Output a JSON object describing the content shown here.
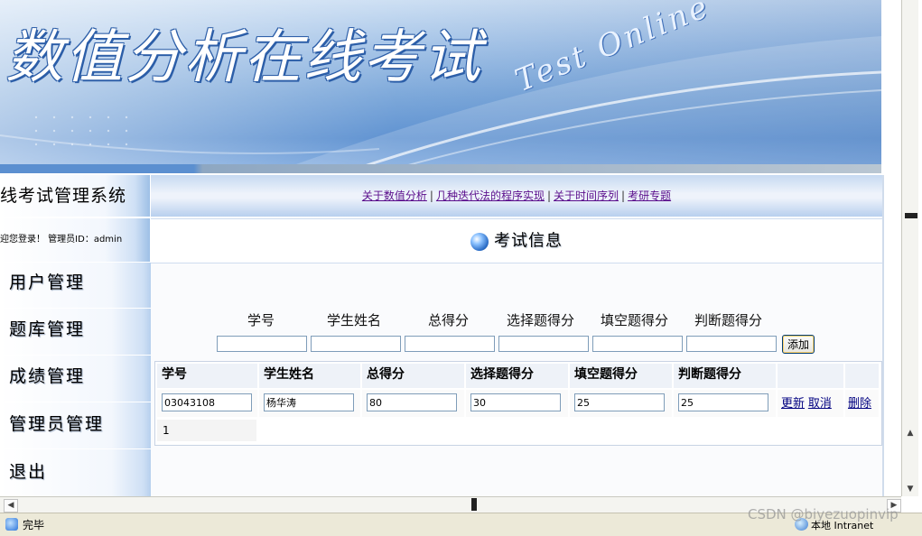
{
  "banner": {
    "title": "数值分析在线考试",
    "subtitle": "Test Online"
  },
  "sidebar": {
    "system_title": "线考试管理系统",
    "welcome": "迎您登录！ 管理员ID：admin",
    "items": [
      {
        "label": "用户管理"
      },
      {
        "label": "题库管理"
      },
      {
        "label": "成绩管理"
      },
      {
        "label": "管理员管理"
      },
      {
        "label": "退出"
      }
    ]
  },
  "toplinks": [
    {
      "label": "关于数值分析"
    },
    {
      "label": "几种迭代法的程序实现"
    },
    {
      "label": "关于时间序列"
    },
    {
      "label": "考研专题"
    }
  ],
  "toplinks_sep": "|",
  "section": {
    "title": "考试信息"
  },
  "add_form": {
    "labels": [
      "学号",
      "学生姓名",
      "总得分",
      "选择题得分",
      "填空题得分",
      "判断题得分"
    ],
    "button_label": "添加"
  },
  "grid": {
    "headers": [
      "学号",
      "学生姓名",
      "总得分",
      "选择题得分",
      "填空题得分",
      "判断题得分"
    ],
    "rows": [
      {
        "student_id": "03043108",
        "name": "杨华涛",
        "total": "80",
        "choice": "30",
        "blank": "25",
        "judge": "25"
      }
    ],
    "update_label": "更新",
    "cancel_label": "取消",
    "delete_label": "删除",
    "pager": "1"
  },
  "statusbar": {
    "status": "完毕",
    "zone": "本地 Intranet"
  },
  "watermark": "CSDN @biyezuopinvip",
  "colors": {
    "link_visited": "#5a0e8c",
    "grid_link": "#000080",
    "banner_blue": "#4d86cc"
  }
}
